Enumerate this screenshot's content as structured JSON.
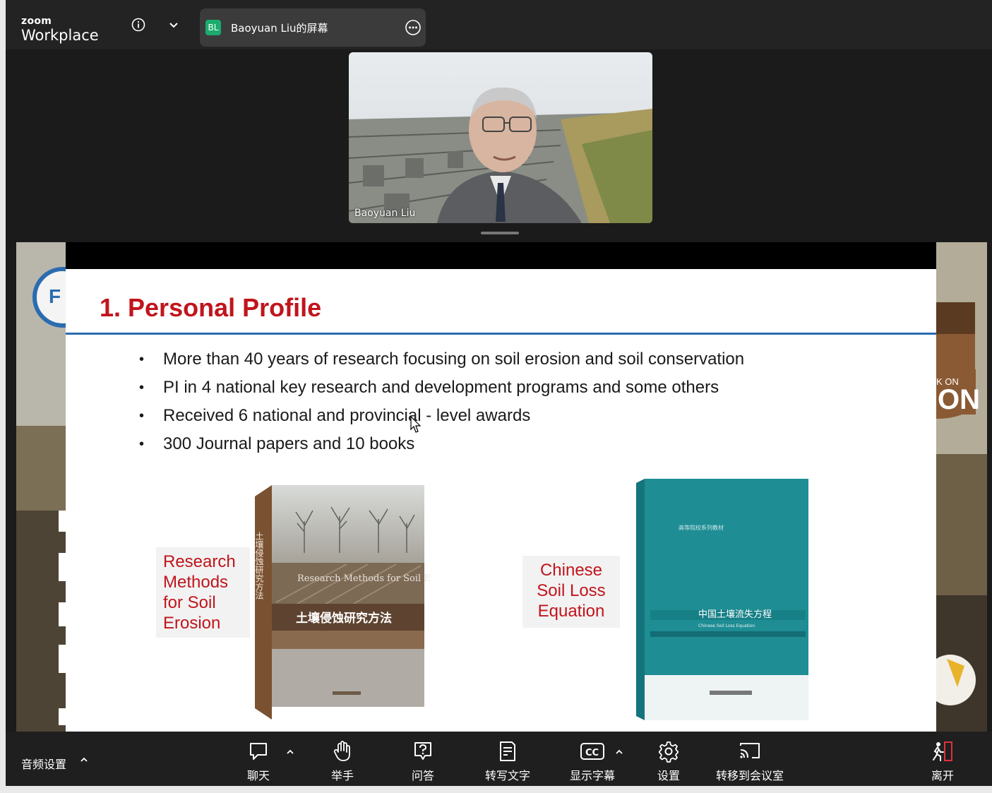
{
  "app": {
    "logo_small": "zoom",
    "logo_big": "Workplace"
  },
  "share_tab": {
    "badge": "BL",
    "label": "Baoyuan Liu的屏幕"
  },
  "video": {
    "participant_name": "Baoyuan Liu"
  },
  "slide": {
    "title": "1. Personal Profile",
    "bullets": [
      "More than 40 years of research focusing on soil erosion and soil conservation",
      "PI in 4 national key research and development programs and some others",
      "Received 6 national and provincial - level awards",
      "300 Journal papers and 10 books"
    ],
    "book_left_label": [
      "Research",
      "Methods",
      "for Soil",
      "Erosion"
    ],
    "book_right_label": [
      "Chinese",
      "Soil Loss",
      "Equation"
    ],
    "book_left_cover": {
      "spine_title": "土壤侵蚀研究方法",
      "english_title": "Research Methods for Soil Erosion",
      "chinese_title": "土壤侵蚀研究方法"
    },
    "book_right_cover": {
      "series": "高等院校系列教材",
      "chinese_title": "中国土壤流失方程",
      "english_title": "Chinese Soil Loss Equation"
    }
  },
  "toolbar": {
    "audio_label": "音频设置",
    "buttons": [
      {
        "label": "聊天",
        "icon": "chat-icon"
      },
      {
        "label": "举手",
        "icon": "hand-icon"
      },
      {
        "label": "问答",
        "icon": "qa-icon"
      },
      {
        "label": "转写文字",
        "icon": "transcript-icon"
      },
      {
        "label": "显示字幕",
        "icon": "cc-icon"
      },
      {
        "label": "设置",
        "icon": "gear-icon"
      },
      {
        "label": "转移到会议室",
        "icon": "cast-icon"
      },
      {
        "label": "离开",
        "icon": "leave-icon"
      }
    ]
  },
  "colors": {
    "accent_red": "#c0151c",
    "rule_blue": "#2a6cb0",
    "badge_green": "#1bac6d",
    "leave_red": "#e0313b"
  }
}
